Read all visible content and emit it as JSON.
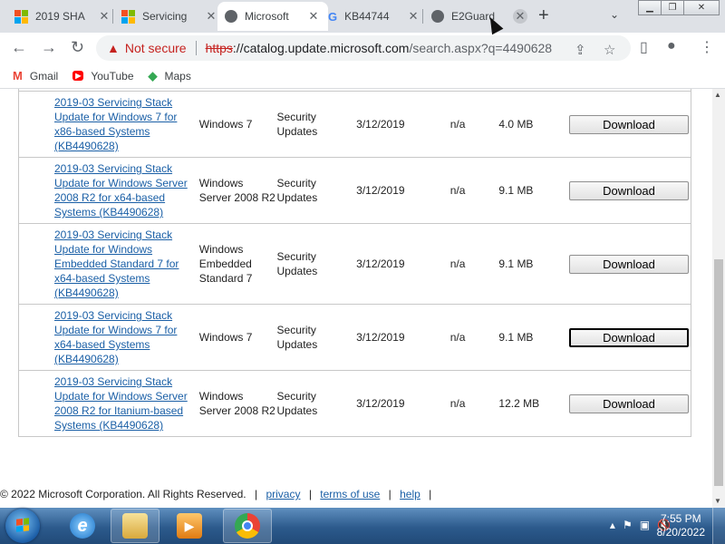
{
  "browser": {
    "tabs": [
      {
        "title": "2019 SHA",
        "icon": "windows-logo-icon",
        "active": false
      },
      {
        "title": "Servicing",
        "icon": "windows-logo-icon",
        "active": false
      },
      {
        "title": "Microsoft",
        "icon": "globe-icon",
        "active": true
      },
      {
        "title": "KB44744",
        "icon": "google-g-icon",
        "active": false
      },
      {
        "title": "E2Guard",
        "icon": "globe-icon",
        "active": false
      }
    ],
    "new_tab_label": "+",
    "tab_search_label": "⌄",
    "security_label": "Not secure",
    "url_protocol": "https",
    "url_host": "://catalog.update.microsoft.com",
    "url_path": "/search.aspx?q=4490628",
    "bookmarks": [
      {
        "label": "Gmail",
        "icon": "gmail-icon"
      },
      {
        "label": "YouTube",
        "icon": "youtube-icon"
      },
      {
        "label": "Maps",
        "icon": "maps-icon"
      }
    ]
  },
  "results": [
    {
      "title": "2019-03 Servicing Stack Update for Windows 7 for x86-based Systems (KB4490628)",
      "product": "Windows 7",
      "classification": "Security Updates",
      "last_updated": "3/12/2019",
      "version": "n/a",
      "size": "4.0 MB",
      "button": "Download"
    },
    {
      "title": "2019-03 Servicing Stack Update for Windows Server 2008 R2 for x64-based Systems (KB4490628)",
      "product": "Windows Server 2008 R2",
      "classification": "Security Updates",
      "last_updated": "3/12/2019",
      "version": "n/a",
      "size": "9.1 MB",
      "button": "Download"
    },
    {
      "title": "2019-03 Servicing Stack Update for Windows Embedded Standard 7 for x64-based Systems (KB4490628)",
      "product": "Windows Embedded Standard 7",
      "classification": "Security Updates",
      "last_updated": "3/12/2019",
      "version": "n/a",
      "size": "9.1 MB",
      "button": "Download"
    },
    {
      "title": "2019-03 Servicing Stack Update for Windows 7 for x64-based Systems (KB4490628)",
      "product": "Windows 7",
      "classification": "Security Updates",
      "last_updated": "3/12/2019",
      "version": "n/a",
      "size": "9.1 MB",
      "button": "Download"
    },
    {
      "title": "2019-03 Servicing Stack Update for Windows Server 2008 R2 for Itanium-based Systems (KB4490628)",
      "product": "Windows Server 2008 R2",
      "classification": "Security Updates",
      "last_updated": "3/12/2019",
      "version": "n/a",
      "size": "12.2 MB",
      "button": "Download"
    }
  ],
  "footer": {
    "copyright": "© 2022 Microsoft Corporation. All Rights Reserved.",
    "links": [
      "privacy",
      "terms of use",
      "help"
    ]
  },
  "taskbar": {
    "time": "7:55 PM",
    "date": "8/20/2022"
  }
}
